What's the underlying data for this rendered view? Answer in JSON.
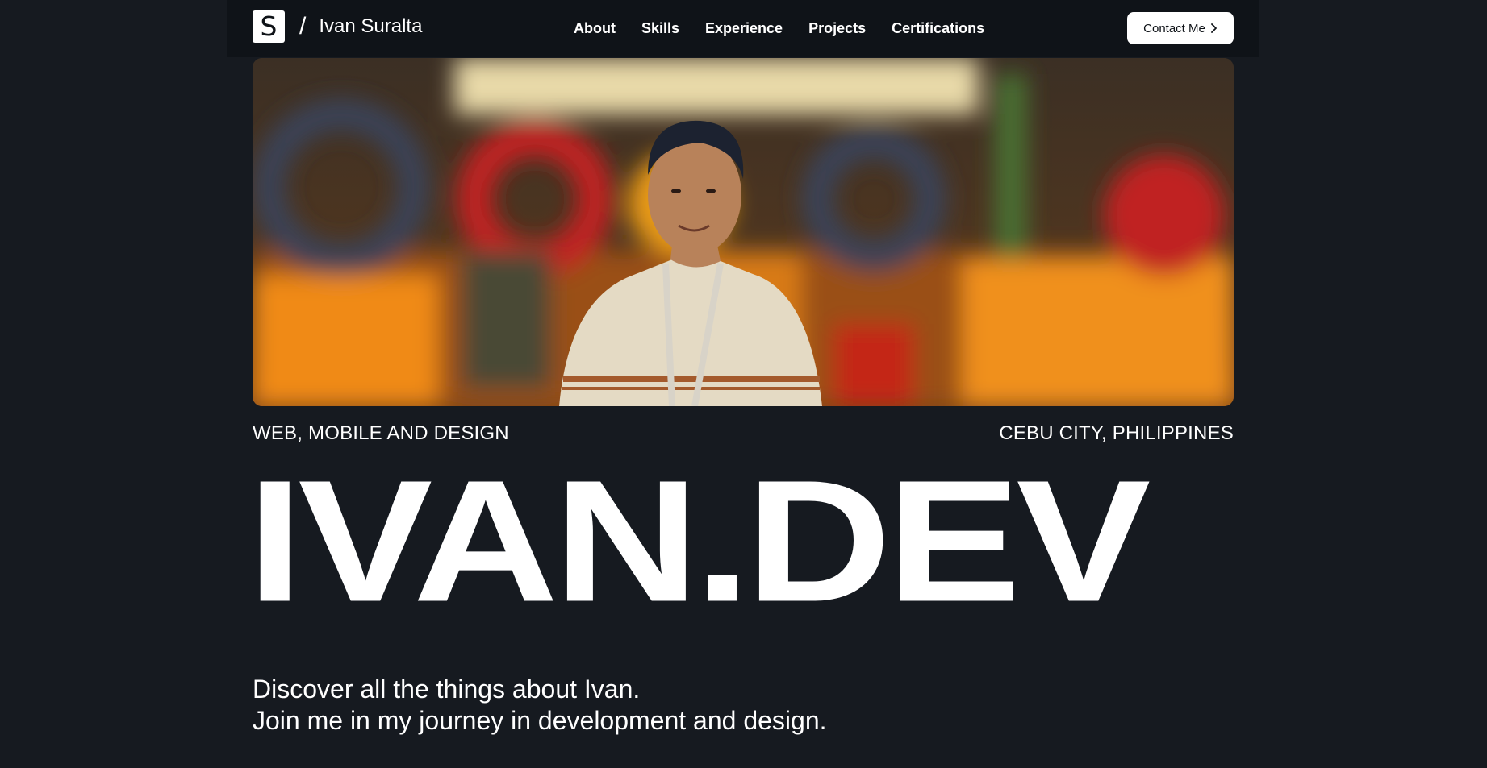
{
  "header": {
    "logo_letter": "S",
    "slash": "/",
    "brand_name": "Ivan Suralta",
    "nav": [
      {
        "label": "About"
      },
      {
        "label": "Skills"
      },
      {
        "label": "Experience"
      },
      {
        "label": "Projects"
      },
      {
        "label": "Certifications"
      }
    ],
    "contact_label": "Contact Me"
  },
  "hero": {
    "background_letters": [
      "G",
      "o",
      "o",
      "g",
      "l",
      "e"
    ]
  },
  "taglines": {
    "left": "WEB, MOBILE AND DESIGN",
    "right": "CEBU CITY, PHILIPPINES"
  },
  "title": "IVAN.DEV",
  "intro": {
    "line1": "Discover all the things about Ivan.",
    "line2": "Join me in my journey in development and design."
  },
  "colors": {
    "background": "#161a20",
    "header": "#0f1318",
    "text": "#ffffff"
  }
}
